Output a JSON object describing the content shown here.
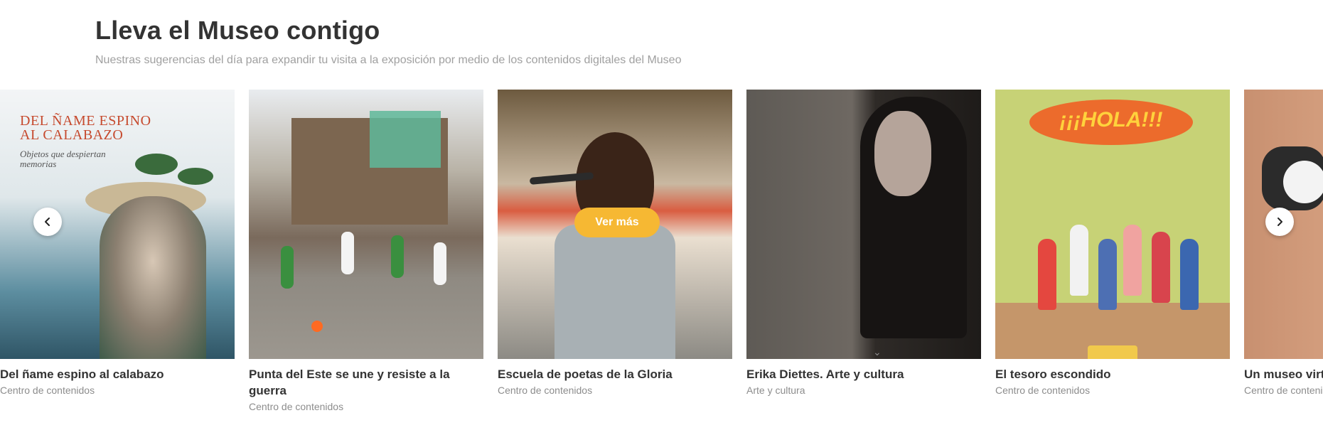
{
  "section": {
    "title": "Lleva el Museo contigo",
    "subtitle": "Nuestras sugerencias del día para expandir tu visita a la exposición por medio de los contenidos digitales del Museo"
  },
  "cards": [
    {
      "title": "Del ñame espino al calabazo",
      "category": "Centro de contenidos",
      "image_text": [
        "DEL ÑAME ESPINO",
        "AL CALABAZO",
        "Objetos que despiertan",
        "memorias"
      ]
    },
    {
      "title": "Punta del Este se une y resiste a la guerra",
      "category": "Centro de contenidos"
    },
    {
      "title": "Escuela de poetas de la Gloria",
      "category": "Centro de contenidos",
      "button_label": "Ver más"
    },
    {
      "title": "Erika Diettes. Arte y cultura",
      "category": "Arte y cultura"
    },
    {
      "title": "El tesoro escondido",
      "category": "Centro de contenidos",
      "image_text": "¡¡¡HOLA!!!"
    },
    {
      "title": "Un museo virtual",
      "category": "Centro de contenidos"
    }
  ],
  "carousel": {
    "prev_icon": "chevron-left-icon",
    "next_icon": "chevron-right-icon"
  },
  "colors": {
    "accent": "#f6b833",
    "title": "#333333",
    "subtitle": "#a0a0a0",
    "category": "#8d8d8d"
  }
}
